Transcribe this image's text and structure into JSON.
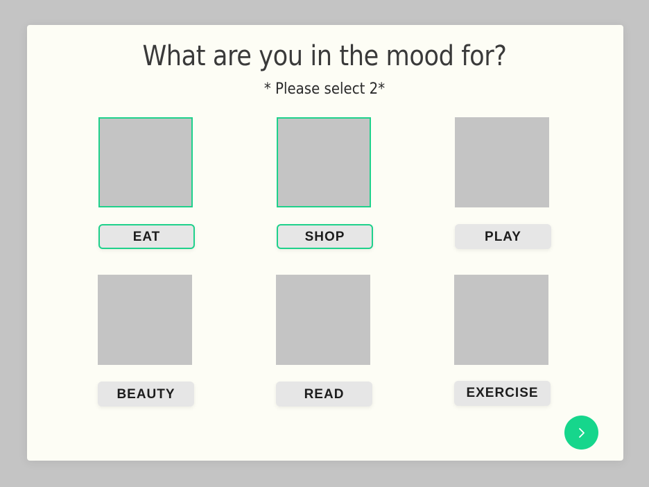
{
  "header": {
    "title": "What are you in the mood for?",
    "subtitle": "* Please select 2*"
  },
  "options": [
    {
      "label": "EAT",
      "selected": true
    },
    {
      "label": "SHOP",
      "selected": true
    },
    {
      "label": "PLAY",
      "selected": false
    },
    {
      "label": "BEAUTY",
      "selected": false
    },
    {
      "label": "READ",
      "selected": false
    },
    {
      "label": "EXERCISE",
      "selected": false
    }
  ],
  "next_button": {
    "icon": "chevron-right-icon"
  },
  "colors": {
    "accent": "#1ed18b",
    "background": "#c4c4c4",
    "card": "#fdfdf5",
    "placeholder": "#c4c4c4",
    "label_bg": "#e6e6e6"
  }
}
